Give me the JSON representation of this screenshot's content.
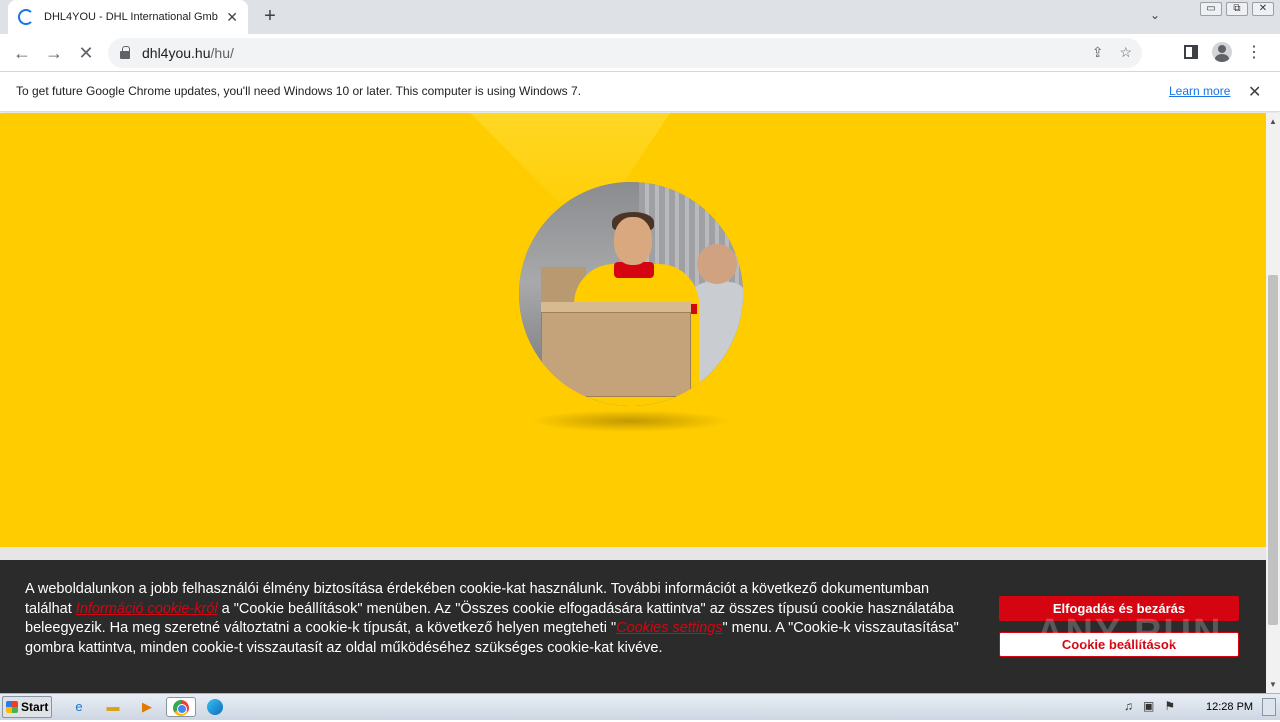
{
  "browser": {
    "tab_title": "DHL4YOU - DHL International GmbH",
    "tab_close": "✕",
    "new_tab": "+",
    "tab_search": "⌄",
    "window_buttons": [
      "▭",
      "⧉",
      "✕"
    ],
    "back": "←",
    "forward": "→",
    "stop": "✕",
    "url_host": "dhl4you.hu",
    "url_path": "/hu/",
    "share": "⇪",
    "bookmark_star": "☆",
    "menu": "⋮"
  },
  "infobar": {
    "message": "To get future Google Chrome updates, you'll need Windows 10 or later. This computer is using Windows 7.",
    "learn_more": "Learn more",
    "close": "✕"
  },
  "page": {
    "background_color": "#ffcc00",
    "hero_image_alt": "DHL courier carrying a parcel"
  },
  "cookie_banner": {
    "text_1": "A weboldalunkon a jobb felhasználói élmény biztosítása érdekében cookie-kat használunk. További információt a következő dokumentumban találhat ",
    "link_1": "Információ cookie-król",
    "text_2": " a \"Cookie beállítások\" menüben. Az \"Összes cookie elfogadására kattintva\" az összes típusú cookie használatába beleegyezik. Ha meg szeretné változtatni a cookie-k típusát, a következő helyen megteheti \"",
    "link_2": "Cookies settings",
    "text_3": "\" menu. A \"Cookie-k visszautasítása\" gombra kattintva, minden cookie-t visszautasít az oldal működéséhez szükséges cookie-kat kivéve.",
    "accept_button": "Elfogadás és bezárás",
    "settings_button": "Cookie beállítások",
    "accent_color": "#d40511",
    "watermark": "ANY RUN"
  },
  "taskbar": {
    "start": "Start",
    "clock": "12:28 PM",
    "tray_icons": [
      "speaker-icon",
      "network-icon",
      "flag-icon"
    ]
  }
}
